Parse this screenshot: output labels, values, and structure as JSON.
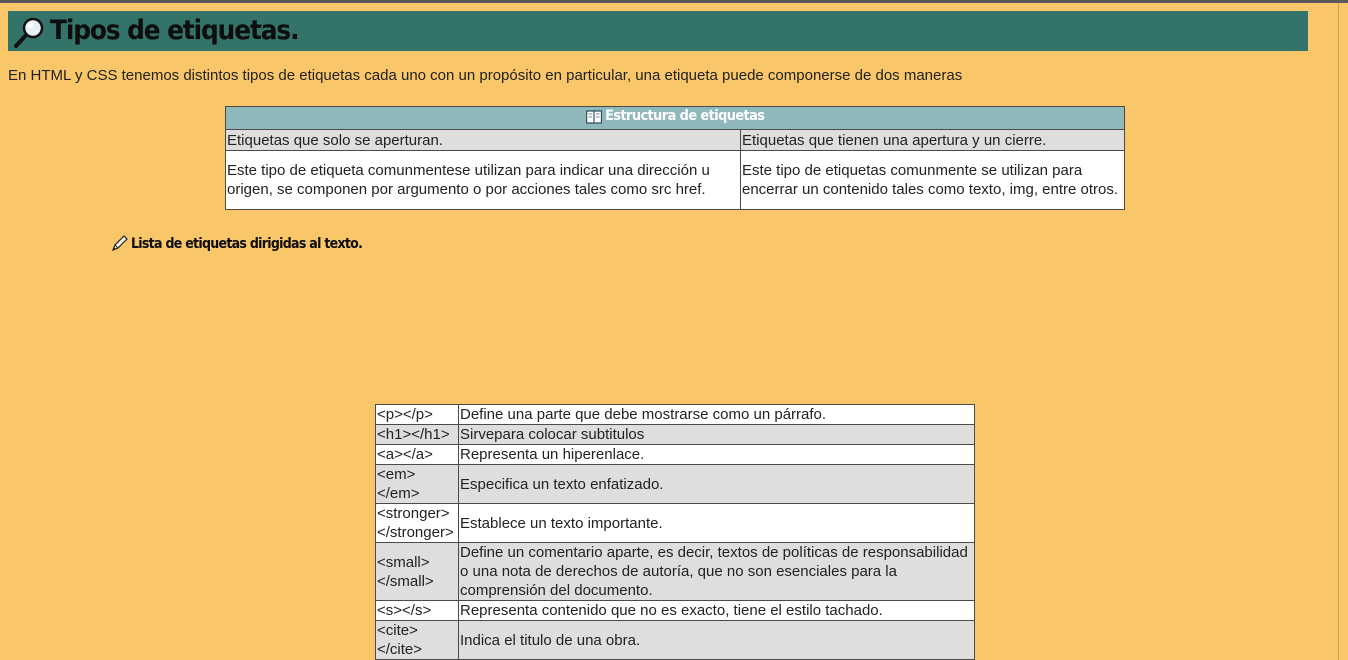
{
  "header": {
    "title": "Tipos de etiquetas.",
    "icon": "magnifier-icon",
    "bg_color": "#337369"
  },
  "intro": "En HTML y CSS tenemos distintos tipos de etiquetas cada uno con un propósito en particular, una etiqueta puede componerse de dos maneras",
  "structure_table": {
    "caption": "Estructura de etiquetas",
    "caption_icon": "book-icon",
    "headers": [
      "Etiquetas que solo se aperturan.",
      "Etiquetas que tienen una apertura y un cierre."
    ],
    "descriptions": [
      "Este tipo de etiqueta comunmentese utilizan para indicar una dirección u origen, se componen por argumento o por acciones tales como src href.",
      "Este tipo de etiquetas comunmente se utilizan para encerrar un contenido tales como texto, img, entre otros."
    ]
  },
  "list_heading": {
    "text": "Lista de etiquetas dirigidas al texto.",
    "icon": "pen-icon"
  },
  "tags_table": [
    {
      "tag": "<p></p>",
      "desc": "Define una parte que debe mostrarse como un párrafo."
    },
    {
      "tag": "<h1></h1>",
      "desc": "Sirvepara colocar subtitulos"
    },
    {
      "tag": "<a></a>",
      "desc": "Representa un hiperenlace."
    },
    {
      "tag": "<em></em>",
      "desc": "Especifica un texto enfatizado."
    },
    {
      "tag": "<stronger></stronger>",
      "desc": "Establece un texto importante."
    },
    {
      "tag": "<small></small>",
      "desc": "Define un comentario aparte, es decir, textos de políticas de responsabilidad o una nota de derechos de autoría, que no son esenciales para la comprensión del documento."
    },
    {
      "tag": "<s></s>",
      "desc": "Representa contenido que no es exacto, tiene el estilo tachado."
    },
    {
      "tag": "<cite></cite>",
      "desc": "Indica el titulo de una obra."
    }
  ],
  "colors": {
    "page_bg": "#f9c66a",
    "caption_bg": "#8fb8bb",
    "row_gray": "#dedede"
  }
}
